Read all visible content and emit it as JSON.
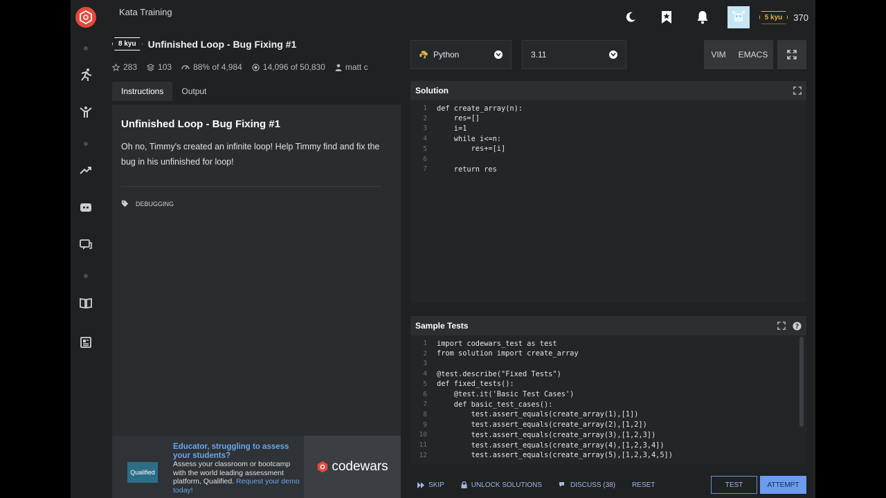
{
  "header": {
    "breadcrumb": "Kata Training",
    "rank": "5 kyu",
    "honor": "370"
  },
  "kata": {
    "rank": "8 kyu",
    "title": "Unfinished Loop - Bug Fixing #1",
    "stats": {
      "stars": "283",
      "collections": "103",
      "satisfaction": "88% of 4,984",
      "completed": "14,096 of 50,830",
      "author": "matt c"
    },
    "tabs": [
      "Instructions",
      "Output"
    ],
    "description": "Oh no, Timmy's created an infinite loop! Help Timmy find and fix the bug in his unfinished for loop!",
    "tag": "DEBUGGING"
  },
  "ad": {
    "logo_text": "Qualified",
    "headline": "Educator, struggling to assess your students?",
    "body": "Assess your classroom or bootcamp with the world leading assessment platform, Qualified.",
    "link": "Request your demo today!",
    "brand": "codewars"
  },
  "editor": {
    "language": "Python",
    "version": "3.11",
    "modes": [
      "VIM",
      "EMACS"
    ],
    "solution_title": "Solution",
    "tests_title": "Sample Tests"
  },
  "solution_code": [
    {
      "n": "1",
      "t": "def create_array(n):"
    },
    {
      "n": "2",
      "t": "    res=[]"
    },
    {
      "n": "3",
      "t": "    i=1"
    },
    {
      "n": "4",
      "t": "    while i<=n:"
    },
    {
      "n": "5",
      "t": "        res+=[i]"
    },
    {
      "n": "6",
      "t": ""
    },
    {
      "n": "7",
      "t": "    return res"
    }
  ],
  "test_code": [
    {
      "n": "1",
      "t": "import codewars_test as test"
    },
    {
      "n": "2",
      "t": "from solution import create_array"
    },
    {
      "n": "3",
      "t": ""
    },
    {
      "n": "4",
      "t": "@test.describe(\"Fixed Tests\")"
    },
    {
      "n": "5",
      "t": "def fixed_tests():"
    },
    {
      "n": "6",
      "t": "    @test.it('Basic Test Cases')"
    },
    {
      "n": "7",
      "t": "    def basic_test_cases():"
    },
    {
      "n": "8",
      "t": "        test.assert_equals(create_array(1),[1])"
    },
    {
      "n": "9",
      "t": "        test.assert_equals(create_array(2),[1,2])"
    },
    {
      "n": "10",
      "t": "        test.assert_equals(create_array(3),[1,2,3])"
    },
    {
      "n": "11",
      "t": "        test.assert_equals(create_array(4),[1,2,3,4])"
    },
    {
      "n": "12",
      "t": "        test.assert_equals(create_array(5),[1,2,3,4,5])"
    }
  ],
  "actions": {
    "skip": "SKIP",
    "unlock": "UNLOCK SOLUTIONS",
    "discuss": "DISCUSS (38)",
    "reset": "RESET",
    "test": "TEST",
    "attempt": "ATTEMPT"
  }
}
